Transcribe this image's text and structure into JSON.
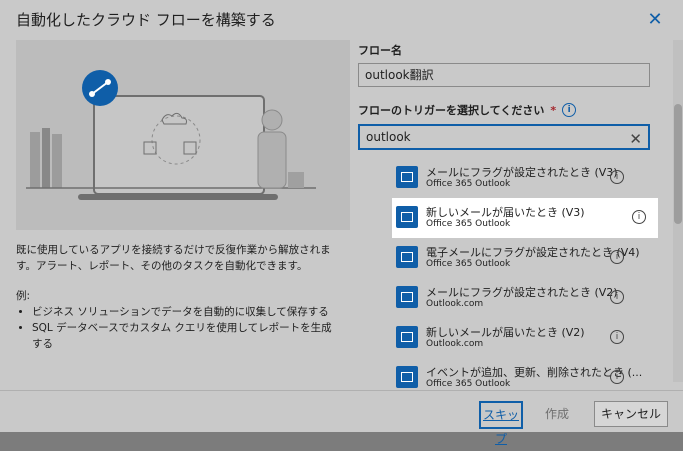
{
  "dialog": {
    "title": "自動化したクラウド フローを構築する",
    "close_glyph": "✕"
  },
  "left": {
    "description": "既に使用しているアプリを接続するだけで反復作業から解放されます。アラート、レポート、その他のタスクを自動化できます。",
    "examples_label": "例:",
    "examples": [
      "ビジネス ソリューションでデータを自動的に収集して保存する",
      "SQL データベースでカスタム クエリを使用してレポートを生成する"
    ]
  },
  "form": {
    "name_label": "フロー名",
    "name_value": "outlook翻訳",
    "trigger_label": "フローのトリガーを選択してください",
    "required_mark": "*",
    "search_value": "outlook",
    "clear_glyph": "✕"
  },
  "triggers": [
    {
      "title": "メールにフラグが設定されたとき (V3)",
      "connector": "Office 365 Outlook",
      "highlight": false
    },
    {
      "title": "新しいメールが届いたとき (V3)",
      "connector": "Office 365 Outlook",
      "highlight": true
    },
    {
      "title": "電子メールにフラグが設定されたとき (V4)",
      "connector": "Office 365 Outlook",
      "highlight": false
    },
    {
      "title": "メールにフラグが設定されたとき (V2)",
      "connector": "Outlook.com",
      "highlight": false
    },
    {
      "title": "新しいメールが届いたとき (V2)",
      "connector": "Outlook.com",
      "highlight": false
    },
    {
      "title": "イベントが追加、更新、削除されたとき (...",
      "connector": "Office 365 Outlook",
      "highlight": false
    }
  ],
  "footer": {
    "skip": "スキップ",
    "create": "作成",
    "cancel": "キャンセル"
  },
  "colors": {
    "accent": "#0f5ea8",
    "required": "#a4262c",
    "overlay": "#c9c9c9"
  }
}
